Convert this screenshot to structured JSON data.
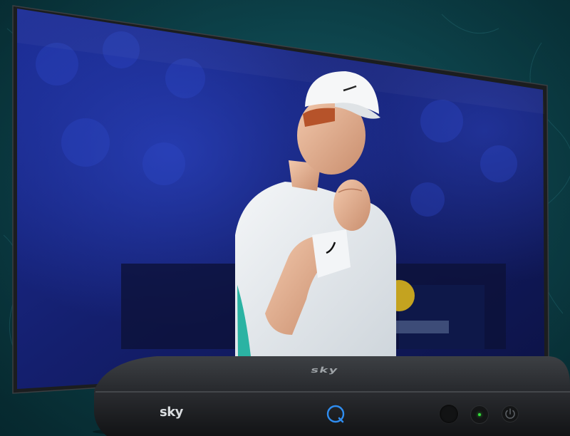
{
  "scene": {
    "description_colors": {
      "background": "#0f505a",
      "tv_frame": "#1a1c1e",
      "stage_blue": "#1c2a8c",
      "box_body": "#2a2c2f",
      "q_accent": "#2f8df0",
      "led_green": "#35e03a"
    }
  },
  "set_top_box": {
    "front_logo": "sky",
    "top_logo": "sky",
    "q_button_icon": "q-ring-icon",
    "power_icon": "power-icon"
  }
}
